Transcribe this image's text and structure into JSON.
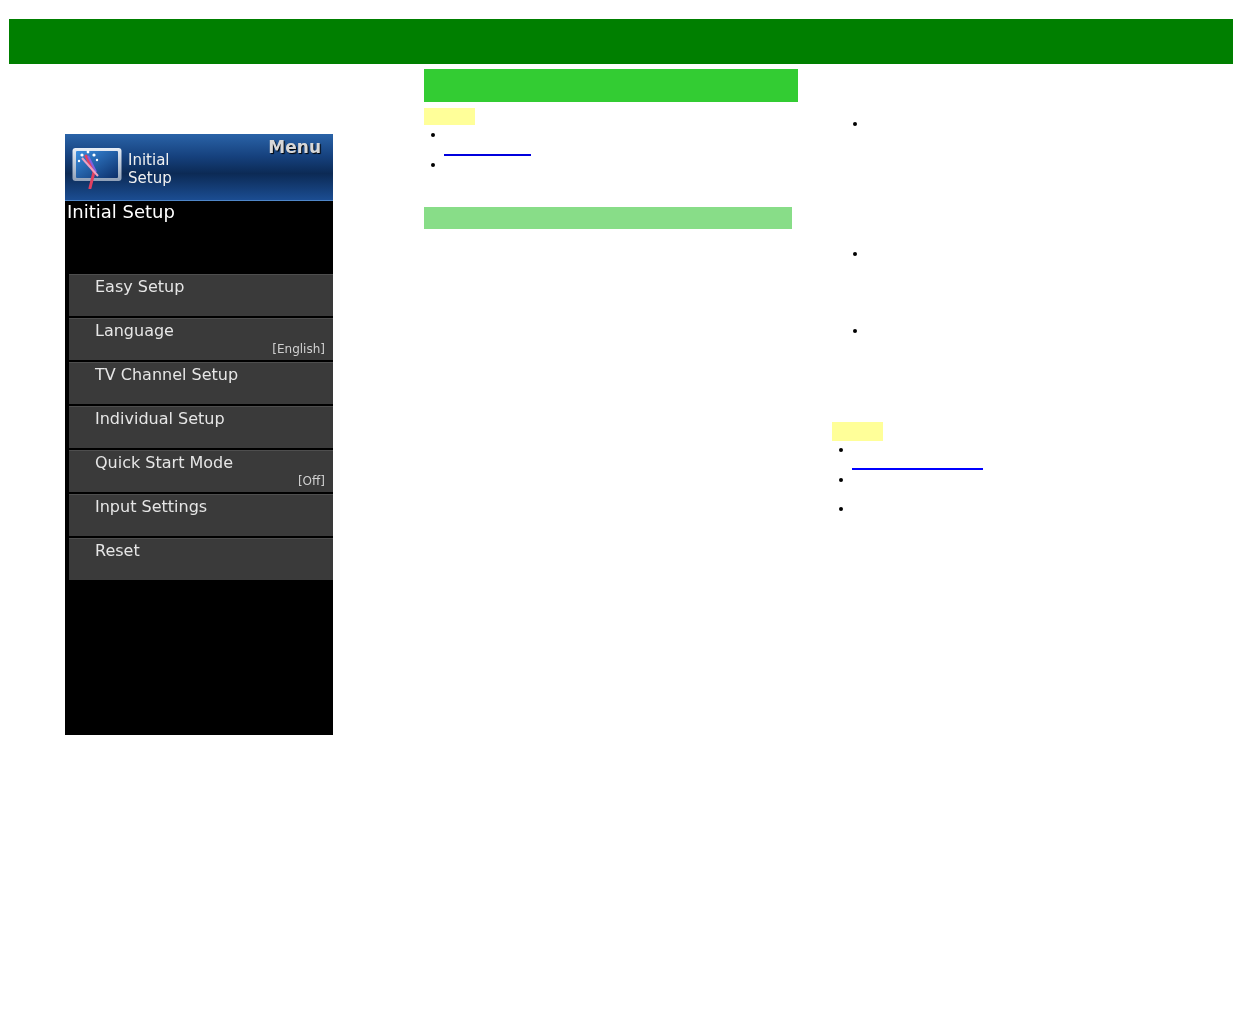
{
  "top_bar": {
    "kind": "plain"
  },
  "tv_menu": {
    "icon_title": "Initial Setup",
    "menu_label": "Menu",
    "heading": "Initial Setup",
    "items": [
      {
        "label": "Easy Setup"
      },
      {
        "label": "Language",
        "value": "[English]"
      },
      {
        "label": "TV Channel Setup"
      },
      {
        "label": "Individual Setup"
      },
      {
        "label": "Quick Start Mode",
        "value": "[Off]"
      },
      {
        "label": "Input Settings"
      },
      {
        "label": "Reset"
      }
    ]
  },
  "middle_column": {
    "blocks": [
      {
        "kind": "heading_bar"
      },
      {
        "kind": "tag"
      },
      {
        "kind": "bullet"
      },
      {
        "kind": "link"
      },
      {
        "kind": "bullet"
      },
      {
        "kind": "subheading_bar"
      }
    ]
  },
  "right_column": {
    "blocks": [
      {
        "kind": "bullet"
      },
      {
        "kind": "bullet"
      },
      {
        "kind": "bullet"
      },
      {
        "kind": "tag"
      },
      {
        "kind": "bullet"
      },
      {
        "kind": "link"
      },
      {
        "kind": "bullet"
      },
      {
        "kind": "bullet"
      }
    ]
  }
}
